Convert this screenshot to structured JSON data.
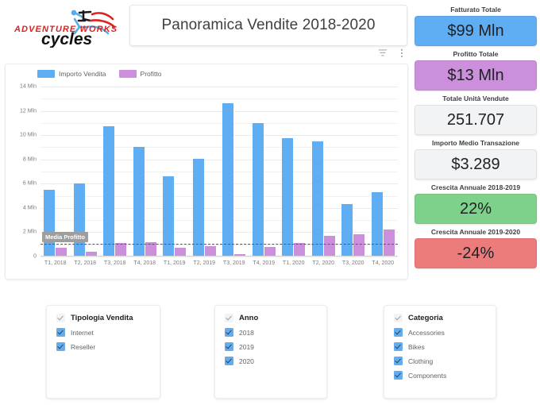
{
  "brand": {
    "name": "Adventure Works Cycles",
    "line1": "ADVENTURE WORKS",
    "line2": "cycles"
  },
  "header": {
    "title": "Panoramica Vendite  2018-2020"
  },
  "chart_toolbar": {
    "filter_icon": "filter-icon",
    "more_icon": "more-vert-icon"
  },
  "kpis": [
    {
      "label": "Fatturato Totale",
      "value": "$99 Mln",
      "color": "#5faef4"
    },
    {
      "label": "Profitto Totale",
      "value": "$13 Mln",
      "color": "#cb8fdc"
    },
    {
      "label": "Totale Unità Vendute",
      "value": "251.707",
      "color": "#f1f3f4"
    },
    {
      "label": "Importo Medio Transazione",
      "value": "$3.289",
      "color": "#f1f3f4"
    },
    {
      "label": "Crescita Annuale 2018-2019",
      "value": "22%",
      "color": "#7ed18b"
    },
    {
      "label": "Crescita Annuale 2019-2020",
      "value": "-24%",
      "color": "#ec7b7b"
    }
  ],
  "filters": [
    {
      "title": "Tipologia Vendita",
      "items": [
        "Internet",
        "Reseller"
      ]
    },
    {
      "title": "Anno",
      "items": [
        "2018",
        "2019",
        "2020"
      ]
    },
    {
      "title": "Categoria",
      "items": [
        "Accessories",
        "Bikes",
        "Clothing",
        "Components"
      ]
    }
  ],
  "chart_data": {
    "type": "bar",
    "title": "Panoramica Vendite  2018-2020",
    "xlabel": "",
    "ylabel": "",
    "ylim": [
      0,
      14
    ],
    "y_unit": "Mln",
    "y_ticks": [
      0,
      2,
      4,
      6,
      8,
      10,
      12,
      14
    ],
    "y_tick_labels": [
      "0",
      "2 Mln",
      "4 Mln",
      "6 Mln",
      "8 Mln",
      "10 Mln",
      "12 Mln",
      "14 Mln"
    ],
    "minor_gridlines": true,
    "grid": true,
    "legend_position": "top-left",
    "categories": [
      "T1, 2018",
      "T2, 2018",
      "T3, 2018",
      "T4, 2018",
      "T1, 2019",
      "T2, 2019",
      "T3, 2019",
      "T4, 2019",
      "T1, 2020",
      "T2, 2020",
      "T3, 2020",
      "T4, 2020"
    ],
    "series": [
      {
        "name": "Importo Vendita",
        "color": "#5faef4",
        "values": [
          5.5,
          6.05,
          10.7,
          9.05,
          6.6,
          8.05,
          12.6,
          11.0,
          9.75,
          9.5,
          4.35,
          5.3
        ]
      },
      {
        "name": "Profitto",
        "color": "#cb8fdc",
        "values": [
          0.75,
          0.4,
          1.1,
          1.15,
          0.75,
          0.85,
          0.2,
          0.8,
          1.1,
          1.7,
          1.85,
          2.25
        ]
      }
    ],
    "reference_line": {
      "label": "Media Profitto",
      "value": 1.05,
      "style": "dashed",
      "color": "#5a5a5a"
    }
  }
}
